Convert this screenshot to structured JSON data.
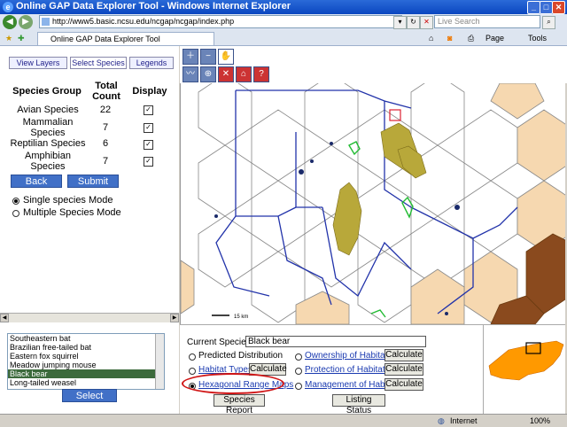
{
  "window": {
    "title": "Online GAP Data Explorer Tool - Windows Internet Explorer"
  },
  "browser": {
    "url": "http://www5.basic.ncsu.edu/ncgap/ncgap/index.php",
    "search_placeholder": "Live Search",
    "tab_title": "Online GAP Data Explorer Tool",
    "page_menu": "Page",
    "tools_menu": "Tools"
  },
  "left_panel": {
    "tabs": [
      "View Layers",
      "Select Species",
      "Legends"
    ],
    "headers": {
      "group": "Species Group",
      "count": "Total Count",
      "display": "Display"
    },
    "rows": [
      {
        "group": "Avian Species",
        "count": "22",
        "checked": true
      },
      {
        "group": "Mammalian Species",
        "count": "7",
        "checked": true
      },
      {
        "group": "Reptilian Species",
        "count": "6",
        "checked": true
      },
      {
        "group": "Amphibian Species",
        "count": "7",
        "checked": true
      }
    ],
    "back_label": "Back",
    "submit_label": "Submit",
    "mode_single": "Single species Mode",
    "mode_multiple": "Multiple Species Mode",
    "species_list": [
      "Southeastern bat",
      "Brazilian free-tailed bat",
      "Eastern fox squirrel",
      "Meadow jumping mouse",
      "Black bear",
      "Long-tailed weasel"
    ],
    "selected_species": "Black bear",
    "select_label": "Select"
  },
  "map": {
    "scale_label": "15 km",
    "colors": {
      "hex": "#f6d8b0",
      "hex_dark": "#8a4a1e",
      "boundary": "#2233aa",
      "habitat": "#b8a83a",
      "green": "#22bb33"
    }
  },
  "bottom_panel": {
    "current_label": "Current Species:",
    "current_value": "Black bear",
    "options": {
      "predicted": "Predicted Distribution",
      "habitat_types": "Habitat Types",
      "hex_range": "Hexagonal Range Maps",
      "ownership": "Ownership of Habitat",
      "protection": "Protection of Habitat",
      "management": "Management of Habitat"
    },
    "calculate_label": "Calculate",
    "species_report_label": "Species Report",
    "listing_status_label": "Listing Status"
  },
  "status_bar": {
    "zone": "Internet",
    "zoom": "100%"
  }
}
